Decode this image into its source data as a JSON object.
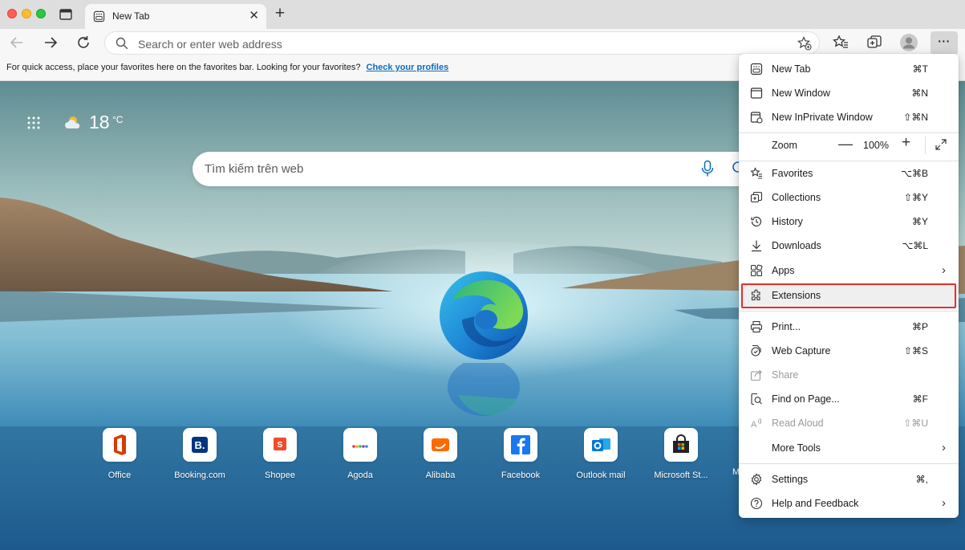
{
  "tab": {
    "title": "New Tab"
  },
  "toolbar": {
    "address_placeholder": "Search or enter web address",
    "more_label": "···"
  },
  "favorites_bar": {
    "message": "For quick access, place your favorites here on the favorites bar. Looking for your favorites?",
    "link": "Check your profiles"
  },
  "weather": {
    "temp": "18",
    "unit": "°C"
  },
  "search": {
    "placeholder": "Tìm kiếm trên web"
  },
  "quick_links": [
    {
      "label": "Office",
      "color": "#d83b01"
    },
    {
      "label": "Booking.com",
      "color": "#003580"
    },
    {
      "label": "Shopee",
      "color": "#ee4d2d"
    },
    {
      "label": "Agoda",
      "color": "#5a5a5a"
    },
    {
      "label": "Alibaba",
      "color": "#ff6a00"
    },
    {
      "label": "Facebook",
      "color": "#1877f2"
    },
    {
      "label": "Outlook mail",
      "color": "#0078d4"
    },
    {
      "label": "Microsoft St...",
      "color": "#222222"
    }
  ],
  "quick_links_partial": "M",
  "menu": {
    "new_tab": {
      "label": "New Tab",
      "shortcut": "⌘T"
    },
    "new_window": {
      "label": "New Window",
      "shortcut": "⌘N"
    },
    "new_inprivate": {
      "label": "New InPrivate Window",
      "shortcut": "⇧⌘N"
    },
    "zoom": {
      "label": "Zoom",
      "value": "100%",
      "minus": "—",
      "plus": "+"
    },
    "favorites": {
      "label": "Favorites",
      "shortcut": "⌥⌘B"
    },
    "collections": {
      "label": "Collections",
      "shortcut": "⇧⌘Y"
    },
    "history": {
      "label": "History",
      "shortcut": "⌘Y"
    },
    "downloads": {
      "label": "Downloads",
      "shortcut": "⌥⌘L"
    },
    "apps": {
      "label": "Apps"
    },
    "extensions": {
      "label": "Extensions"
    },
    "print": {
      "label": "Print...",
      "shortcut": "⌘P"
    },
    "web_capture": {
      "label": "Web Capture",
      "shortcut": "⇧⌘S"
    },
    "share": {
      "label": "Share"
    },
    "find_on_page": {
      "label": "Find on Page...",
      "shortcut": "⌘F"
    },
    "read_aloud": {
      "label": "Read Aloud",
      "shortcut": "⇧⌘U"
    },
    "more_tools": {
      "label": "More Tools"
    },
    "settings": {
      "label": "Settings",
      "shortcut": "⌘,"
    },
    "help": {
      "label": "Help and Feedback"
    }
  },
  "colors": {
    "accent_link": "#0f6cbd",
    "highlight_border": "#e03030"
  }
}
